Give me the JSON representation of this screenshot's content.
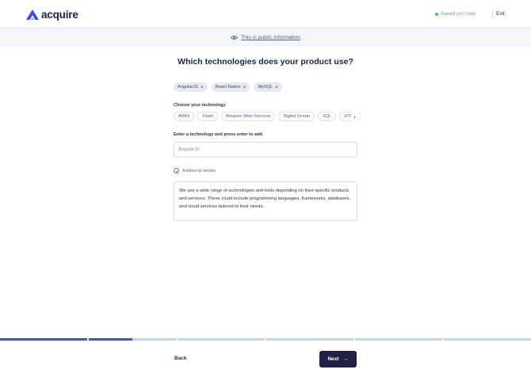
{
  "header": {
    "logo_text": "acquire",
    "saved_text": "Saved just now",
    "exit_label": "Exit"
  },
  "public_bar": {
    "icon": "eye-icon",
    "text": "This is public information"
  },
  "title": "Which technologies does your product use?",
  "selected_technologies": [
    "AngularJS",
    "React Native",
    "MySQL"
  ],
  "choose": {
    "label": "Choose your technology",
    "options": [
      "ARKit",
      "Flash",
      "Amazon Web Services",
      "Digital Ocean",
      "SQL",
      "HTML"
    ]
  },
  "tech_input": {
    "label": "Enter a technology and press enter to add",
    "value": "AngularJS"
  },
  "additional_details": {
    "label": "Additional details",
    "text": "We use a wide range of technologies and tools depending on their specific products and services. These could include programming languages, frameworks, databases, and cloud services tailored to their needs."
  },
  "progress": {
    "total_steps": 6,
    "completed_steps": 1.5
  },
  "footer": {
    "back_label": "Back",
    "next_label": "Next"
  },
  "colors": {
    "brand": "#3b4fd8",
    "progress_done": "#4453d6",
    "progress_todo": "#c9d4ee",
    "primary_button": "#1d2145",
    "saved_dot": "#3fc35b"
  }
}
